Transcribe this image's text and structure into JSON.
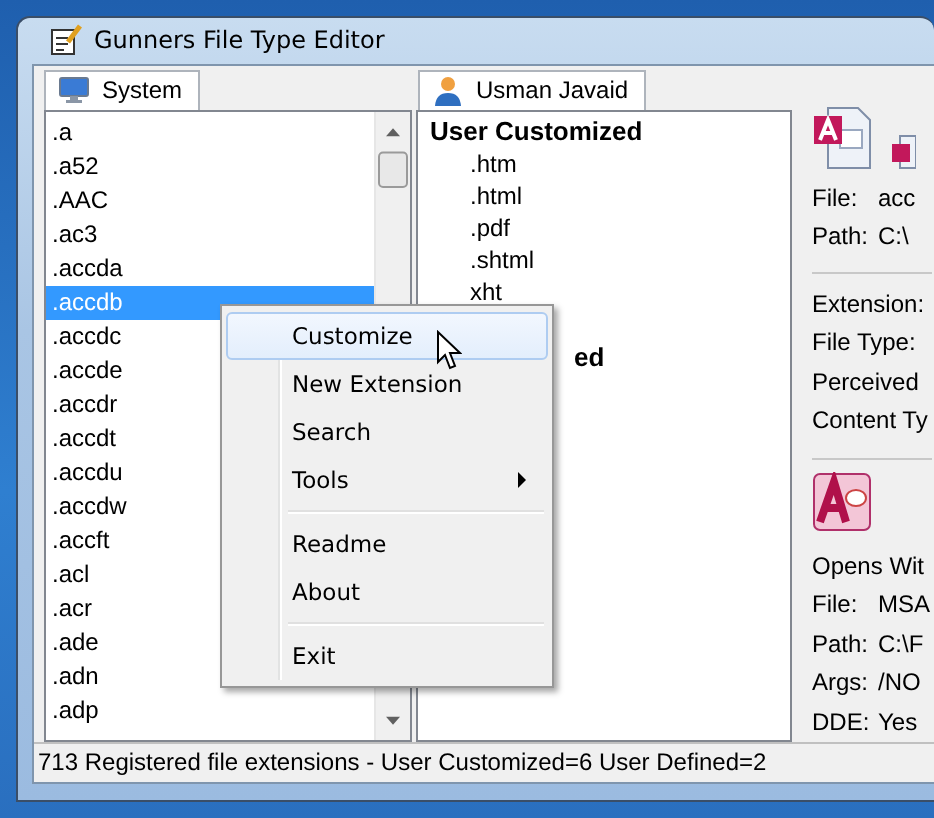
{
  "window": {
    "title": "Gunners File Type Editor"
  },
  "system_pane": {
    "tab": "System",
    "items": [
      {
        "label": ".a",
        "selected": false
      },
      {
        "label": ".a52",
        "selected": false
      },
      {
        "label": ".AAC",
        "selected": false
      },
      {
        "label": ".ac3",
        "selected": false
      },
      {
        "label": ".accda",
        "selected": false
      },
      {
        "label": ".accdb",
        "selected": true
      },
      {
        "label": ".accdc",
        "selected": false
      },
      {
        "label": ".accde",
        "selected": false
      },
      {
        "label": ".accdr",
        "selected": false
      },
      {
        "label": ".accdt",
        "selected": false
      },
      {
        "label": ".accdu",
        "selected": false
      },
      {
        "label": ".accdw",
        "selected": false
      },
      {
        "label": ".accft",
        "selected": false
      },
      {
        "label": ".acl",
        "selected": false
      },
      {
        "label": ".acr",
        "selected": false
      },
      {
        "label": ".ade",
        "selected": false
      },
      {
        "label": ".adn",
        "selected": false
      },
      {
        "label": ".adp",
        "selected": false
      }
    ]
  },
  "user_pane": {
    "tab": "Usman Javaid",
    "groups": [
      {
        "label": "User Customized",
        "items": [
          ".htm",
          ".html",
          ".pdf",
          ".shtml",
          "xht"
        ]
      },
      {
        "label": "ed"
      }
    ]
  },
  "details": {
    "file_info": [
      {
        "label": "File:",
        "value": "acc"
      },
      {
        "label": "Path:",
        "value": "C:\\"
      }
    ],
    "properties": [
      "Extension:",
      "File Type:",
      "Perceived",
      "Content Ty"
    ],
    "opens_with": {
      "title": "Opens Wit",
      "rows": [
        {
          "label": "File:",
          "value": "MSA"
        },
        {
          "label": "Path:",
          "value": "C:\\F"
        },
        {
          "label": "Args:",
          "value": "/NO"
        },
        {
          "label": "DDE:",
          "value": "Yes"
        }
      ]
    }
  },
  "context_menu": {
    "items": [
      {
        "kind": "item",
        "label": "Customize",
        "selected": true
      },
      {
        "kind": "item",
        "label": "New Extension",
        "selected": false
      },
      {
        "kind": "item",
        "label": "Search",
        "selected": false
      },
      {
        "kind": "submenu",
        "label": "Tools",
        "selected": false
      },
      {
        "kind": "separator"
      },
      {
        "kind": "item",
        "label": "Readme",
        "selected": false
      },
      {
        "kind": "item",
        "label": "About",
        "selected": false
      },
      {
        "kind": "separator"
      },
      {
        "kind": "item",
        "label": "Exit",
        "selected": false
      }
    ]
  },
  "status_bar": "713 Registered file extensions - User Customized=6  User Defined=2"
}
